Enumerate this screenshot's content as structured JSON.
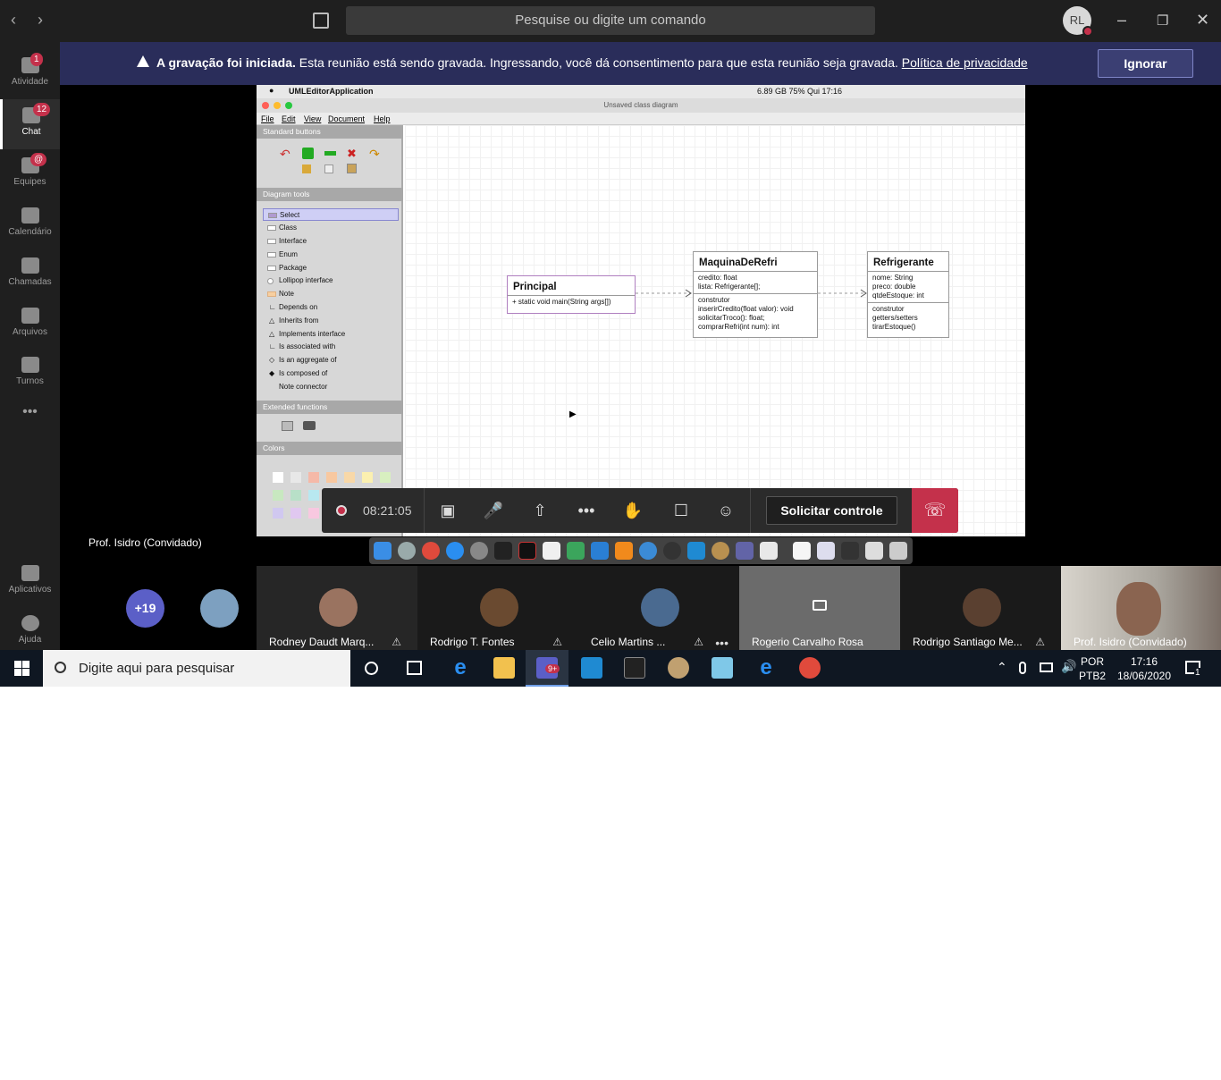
{
  "teams": {
    "search_placeholder": "Pesquise ou digite um comando",
    "user_initials": "RL",
    "rail": [
      {
        "label": "Atividade",
        "badge": "1",
        "icon": "bell-icon"
      },
      {
        "label": "Chat",
        "badge": "12",
        "icon": "chat-icon"
      },
      {
        "label": "Equipes",
        "badge": "@",
        "icon": "teams-icon"
      },
      {
        "label": "Calendário",
        "badge": "",
        "icon": "calendar-icon"
      },
      {
        "label": "Chamadas",
        "badge": "",
        "icon": "phone-icon"
      },
      {
        "label": "Arquivos",
        "badge": "",
        "icon": "files-icon"
      },
      {
        "label": "Turnos",
        "badge": "",
        "icon": "clock-icon"
      },
      {
        "label": "•••",
        "badge": "",
        "icon": "more-icon"
      },
      {
        "label": "Aplicativos",
        "badge": "",
        "icon": "apps-icon"
      },
      {
        "label": "Ajuda",
        "badge": "",
        "icon": "help-icon"
      }
    ],
    "banner": {
      "bold": "A gravação foi iniciada.",
      "text": " Esta reunião está sendo gravada. Ingressando, você dá consentimento para que esta reunião seja gravada. ",
      "link": "Política de privacidade",
      "button": "Ignorar"
    }
  },
  "shared_screen": {
    "mac_app_name": "UMLEditorApplication",
    "mac_status": "6.89 GB    75%    Qui 17:16",
    "window_title": "Unsaved class diagram",
    "menu": [
      "File",
      "Edit",
      "View",
      "Document",
      "Help"
    ],
    "sections": {
      "standard": "Standard buttons",
      "diagram": "Diagram tools",
      "extended": "Extended functions",
      "colors": "Colors"
    },
    "tools": [
      "Select",
      "Class",
      "Interface",
      "Enum",
      "Package",
      "Lollipop interface",
      "Note",
      "Depends on",
      "Inherits from",
      "Implements interface",
      "Is associated with",
      "Is an aggregate of",
      "Is composed of",
      "Note connector"
    ],
    "classes": {
      "principal": {
        "name": "Principal",
        "methods": [
          "+ static void main(String args[])"
        ]
      },
      "maquina": {
        "name": "MaquinaDeRefri",
        "attrs": [
          "credito: float",
          "lista: Refrigerante[];"
        ],
        "methods": [
          "construtor",
          "inserirCredito(float valor): void",
          "solicitarTroco(): float;",
          "comprarRefri(int num): int"
        ]
      },
      "refrigerante": {
        "name": "Refrigerante",
        "attrs": [
          "nome: String",
          "preco: double",
          "qtdeEstoque: int"
        ],
        "methods": [
          "construtor",
          "getters/setters",
          "tirarEstoque()"
        ]
      }
    }
  },
  "meeting": {
    "elapsed": "08:21:05",
    "request_control": "Solicitar controle",
    "presenter": "Prof. Isidro (Convidado)",
    "overflow": "+19",
    "participants": [
      {
        "name": "Rodney Daudt Marq...",
        "muted": true
      },
      {
        "name": "Rodrigo T. Fontes",
        "muted": true
      },
      {
        "name": "Celio Martins ...",
        "muted": true
      },
      {
        "name": "Rogerio Carvalho Rosa",
        "muted": false
      },
      {
        "name": "Rodrigo Santiago Me...",
        "muted": true
      },
      {
        "name": "Prof. Isidro (Convidado)",
        "muted": false
      }
    ]
  },
  "taskbar": {
    "search": "Digite aqui para pesquisar",
    "lang1": "POR",
    "lang2": "PTB2",
    "time": "17:16",
    "date": "18/06/2020",
    "notif_count": "1",
    "teams_badge": "9+"
  }
}
